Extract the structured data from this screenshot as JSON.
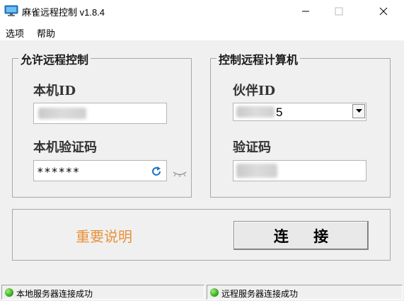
{
  "window": {
    "title": "麻雀远程控制 v1.8.4",
    "app_icon": "monitor-icon",
    "controls": [
      "minimize-icon",
      "maximize-icon",
      "close-icon"
    ]
  },
  "menu": {
    "options": "选项",
    "help": "帮助"
  },
  "local_panel": {
    "legend": "允许远程控制",
    "id_label": "本机ID",
    "id_value": "",
    "code_label": "本机验证码",
    "code_value": "******",
    "refresh_icon": "refresh-icon",
    "eye_icon": "eye-closed-icon"
  },
  "remote_panel": {
    "legend": "控制远程计算机",
    "partner_label": "伙伴ID",
    "partner_value": "5",
    "code_label": "验证码",
    "code_value": ""
  },
  "actions": {
    "important_notes": "重要说明",
    "connect": "连 接"
  },
  "status": {
    "local": "本地服务器连接成功",
    "remote": "远程服务器连接成功"
  },
  "colors": {
    "accent_orange": "#e8913a",
    "status_green": "#2e9e1a",
    "refresh_blue": "#1a73c8"
  }
}
